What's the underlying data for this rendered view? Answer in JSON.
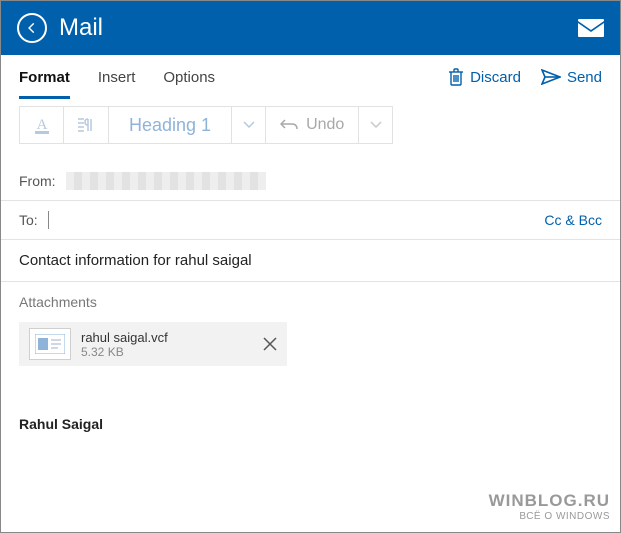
{
  "header": {
    "app_title": "Mail"
  },
  "tabs": {
    "format": "Format",
    "insert": "Insert",
    "options": "Options"
  },
  "actions": {
    "discard": "Discard",
    "send": "Send"
  },
  "toolbar": {
    "heading_style": "Heading 1",
    "undo_label": "Undo"
  },
  "fields": {
    "from_label": "From:",
    "to_label": "To:",
    "ccbcc": "Cc & Bcc"
  },
  "subject": "Contact information for rahul saigal",
  "attachments": {
    "section_label": "Attachments",
    "items": [
      {
        "name": "rahul saigal.vcf",
        "size": "5.32 KB"
      }
    ]
  },
  "body": {
    "signature": "Rahul Saigal"
  },
  "watermark": {
    "line1": "WINBLOG.RU",
    "line2": "ВСЁ О WINDOWS"
  },
  "colors": {
    "accent": "#0060AC"
  }
}
